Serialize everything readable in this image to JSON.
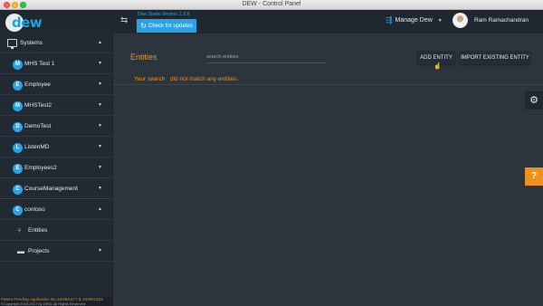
{
  "window": {
    "title": "DEW - Control Panel"
  },
  "header": {
    "logo_text": "dew",
    "version_text": "Dew Studio Version: 1.0.8",
    "check_updates_label": "Check for updates",
    "manage_label": "Manage Dew",
    "user_name": "Ram Ramachandran"
  },
  "sidebar": {
    "section_label": "Systems",
    "items": [
      {
        "initial": "M",
        "label": "MHS Test 1"
      },
      {
        "initial": "E",
        "label": "Employee"
      },
      {
        "initial": "M",
        "label": "MHSTest2"
      },
      {
        "initial": "D",
        "label": "DemoTest"
      },
      {
        "initial": "L",
        "label": "ListenMD"
      },
      {
        "initial": "E",
        "label": "Employees2"
      },
      {
        "initial": "C",
        "label": "CourseManagement"
      },
      {
        "initial": "C",
        "label": "contoso"
      }
    ],
    "sub_items": [
      {
        "label": "Entities"
      },
      {
        "label": "Projects"
      }
    ]
  },
  "footer": {
    "patent": "Patent Pending Application No.15/393,577 & 15/393,503",
    "copyright": "©Copyright 2016-2017 by DEW, All Rights Reserved"
  },
  "main": {
    "title": "Entities",
    "search_placeholder": "search entities",
    "add_entity_label": "ADD ENTITY",
    "import_label": "IMPORT EXISTING ENTITY",
    "notice": "Your search   did not match any entities."
  },
  "colors": {
    "accent": "#f0911a",
    "primary": "#29a3e5",
    "bg": "#2c353d",
    "sidebar": "#212a33"
  },
  "icons": [
    "collapse-sidebar-icon",
    "refresh-icon",
    "manage-icon",
    "monitor-icon",
    "settings-gear-icon",
    "help-icon"
  ]
}
